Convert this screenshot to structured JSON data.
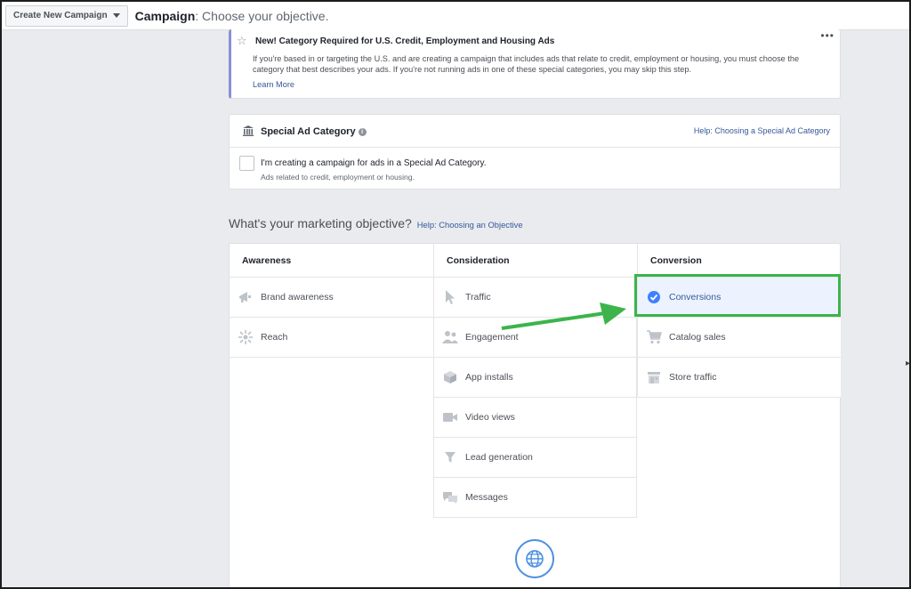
{
  "topbar": {
    "create_button": "Create New Campaign",
    "crumb_title": "Campaign",
    "crumb_subtitle": ": Choose your objective."
  },
  "notice": {
    "title": "New! Category Required for U.S. Credit, Employment and Housing Ads",
    "body": "If you're based in or targeting the U.S. and are creating a campaign that includes ads that relate to credit, employment or housing, you must choose the category that best describes your ads. If you're not running ads in one of these special categories, you may skip this step.",
    "link": "Learn More",
    "more": "•••"
  },
  "special": {
    "title": "Special Ad Category",
    "help": "Help: Choosing a Special Ad Category",
    "checkbox_label": "I'm creating a campaign for ads in a Special Ad Category.",
    "checkbox_sub": "Ads related to credit, employment or housing."
  },
  "objective": {
    "heading": "What's your marketing objective?",
    "help": "Help: Choosing an Objective"
  },
  "columns": [
    {
      "title": "Awareness",
      "items": [
        "Brand awareness",
        "Reach"
      ]
    },
    {
      "title": "Consideration",
      "items": [
        "Traffic",
        "Engagement",
        "App installs",
        "Video views",
        "Lead generation",
        "Messages"
      ]
    },
    {
      "title": "Conversion",
      "items": [
        "Conversions",
        "Catalog sales",
        "Store traffic"
      ]
    }
  ],
  "selected_objective": "Conversions",
  "colors": {
    "accent": "#385898",
    "highlight": "#3cb44b",
    "selected_bg": "#ecf3ff"
  }
}
